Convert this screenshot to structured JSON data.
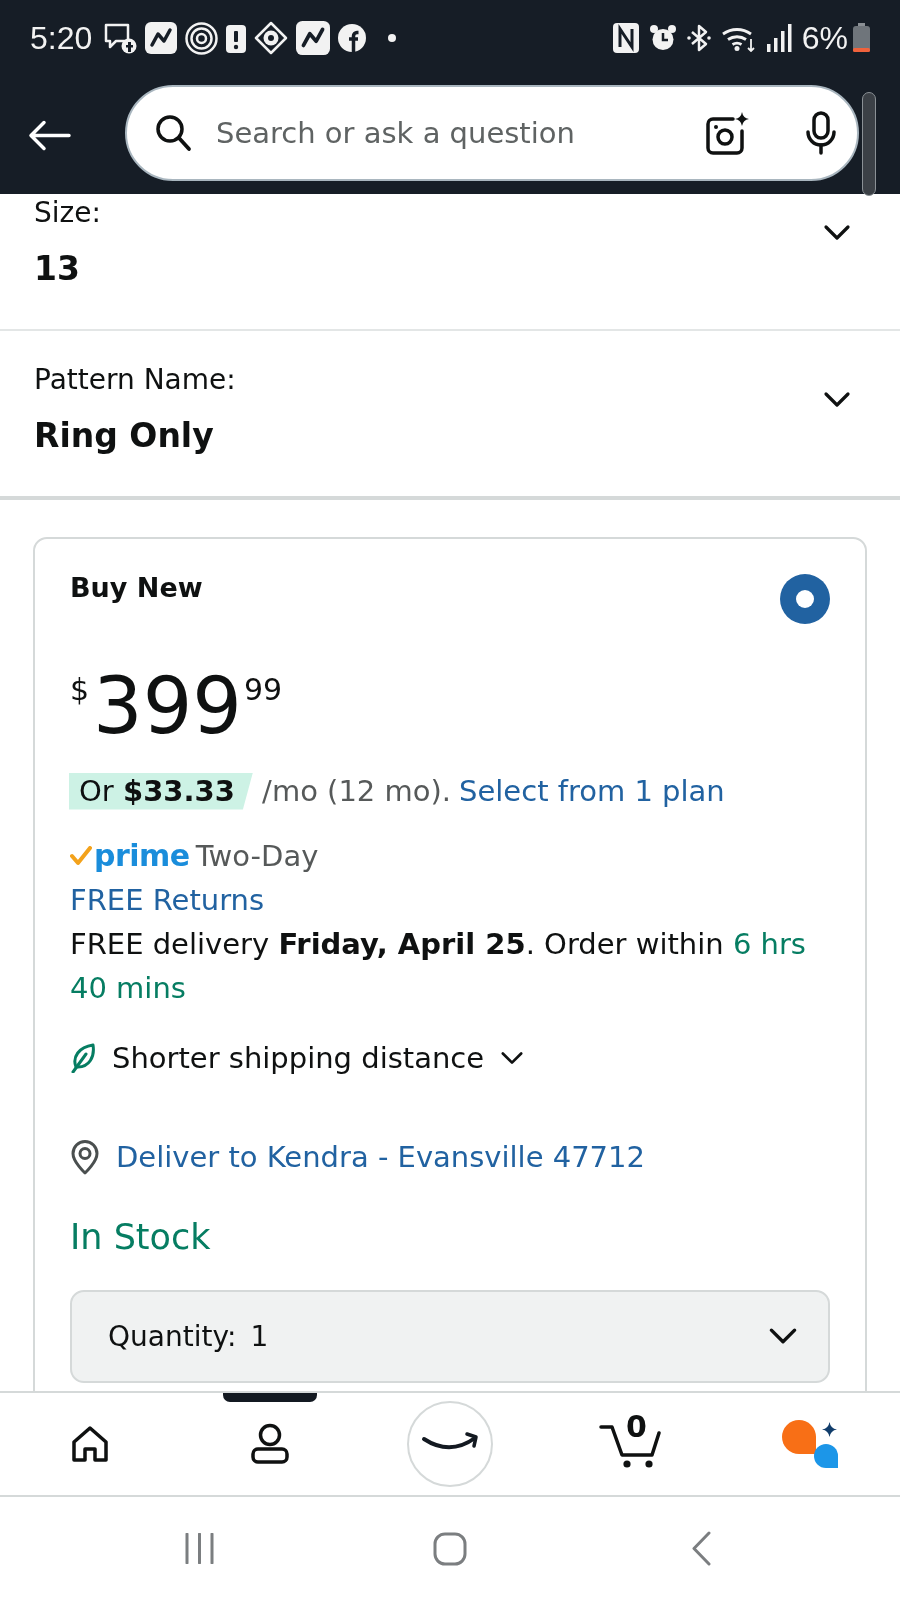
{
  "status_bar": {
    "time": "5:20",
    "battery": "6%"
  },
  "search": {
    "placeholder": "Search or ask a question"
  },
  "options": [
    {
      "label": "Size:",
      "value": "13"
    },
    {
      "label": "Pattern Name:",
      "value": "Ring Only"
    }
  ],
  "offer": {
    "title": "Buy New",
    "selected": true,
    "price": {
      "currency": "$",
      "whole": "399",
      "fraction": "99"
    },
    "installment": {
      "amount": "Or **$33.33**",
      "terms": "/mo (12 mo).",
      "link": "Select from 1 plan"
    },
    "prime": {
      "logo": "prime",
      "speed": "Two-Day"
    },
    "returns": "FREE Returns",
    "delivery": {
      "text": "FREE delivery **Friday, April 25**. Order within",
      "countdown": "6 hrs 40 mins"
    },
    "shipping_note": "Shorter shipping distance",
    "deliver_to": "Deliver to Kendra - Evansville 47712",
    "availability": "In Stock",
    "quantity": {
      "label": "Quantity:",
      "value": "1"
    }
  },
  "bottom_nav": [
    {
      "kind": "home",
      "selected": false
    },
    {
      "kind": "account",
      "selected": true
    },
    {
      "kind": "logo",
      "selected": false
    },
    {
      "kind": "cart",
      "selected": false,
      "count": "0"
    },
    {
      "kind": "assistant",
      "selected": false
    }
  ]
}
